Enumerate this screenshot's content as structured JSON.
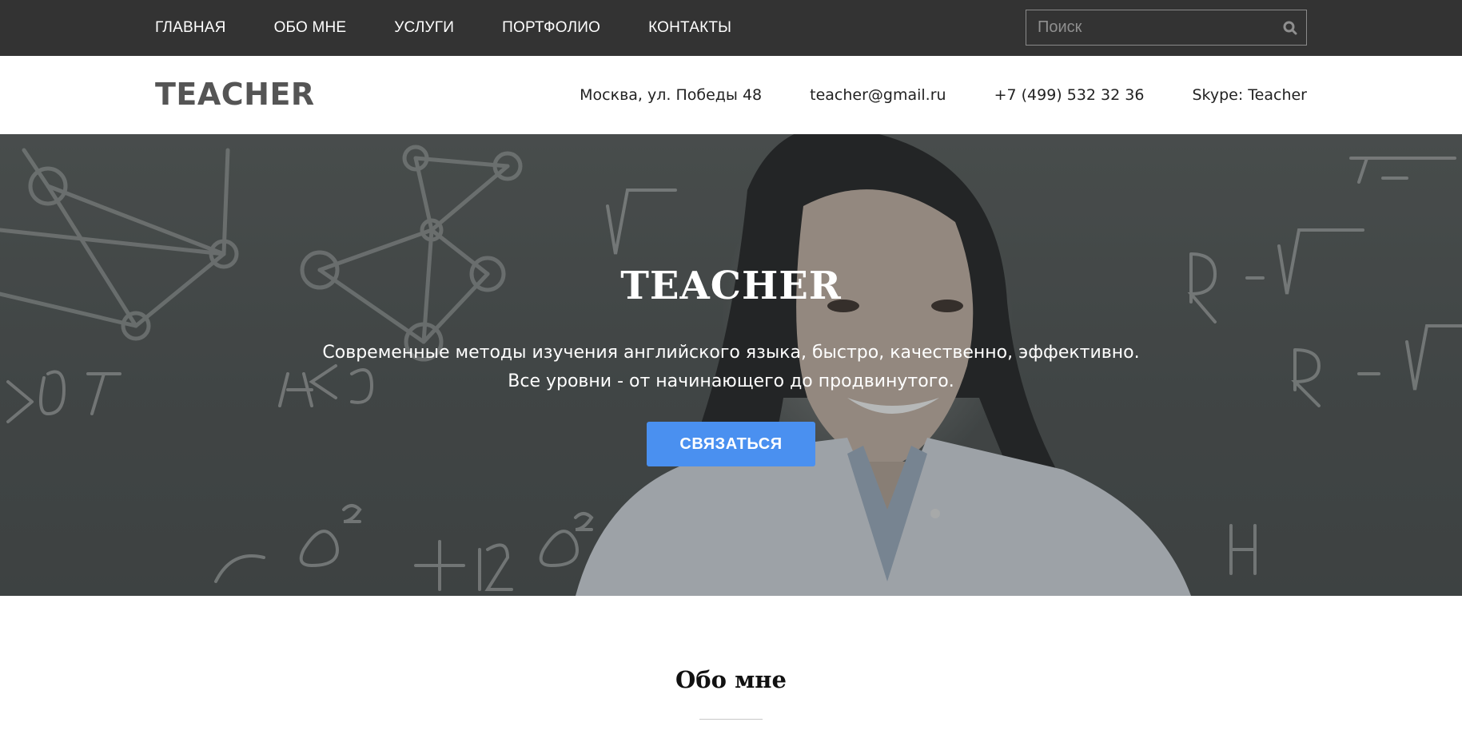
{
  "nav": {
    "items": [
      {
        "label": "ГЛАВНАЯ"
      },
      {
        "label": "ОБО МНЕ"
      },
      {
        "label": "УСЛУГИ"
      },
      {
        "label": "ПОРТФОЛИО"
      },
      {
        "label": "КОНТАКТЫ"
      }
    ]
  },
  "search": {
    "placeholder": "Поиск",
    "value": "",
    "icon": "search-icon"
  },
  "header": {
    "logo": "TEACHER",
    "address": "Москва, ул. Победы 48",
    "email": "teacher@gmail.ru",
    "phone": "+7 (499) 532 32 36",
    "skype": "Skype: Teacher"
  },
  "hero": {
    "title": "TEACHER",
    "subtitle_line1": "Современные методы изучения английского языка, быстро, качественно, эффективно.",
    "subtitle_line2": "Все уровни - от начинающего до продвинутого.",
    "button_label": "СВЯЗАТЬСЯ"
  },
  "about": {
    "title": "Обо мне"
  },
  "colors": {
    "topbar": "#333333",
    "accent_button": "#4a90f0",
    "logo": "#555555"
  }
}
